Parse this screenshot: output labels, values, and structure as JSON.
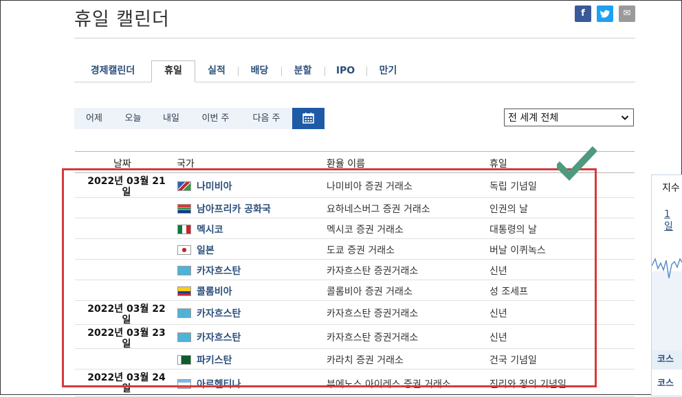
{
  "page": {
    "title": "휴일 캘린더"
  },
  "share": {
    "facebook": "f",
    "twitter": "t",
    "email": "✉"
  },
  "tabs": [
    {
      "label": "경제캘린더"
    },
    {
      "label": "휴일",
      "active": true
    },
    {
      "label": "실적"
    },
    {
      "label": "배당"
    },
    {
      "label": "분할"
    },
    {
      "label": "IPO"
    },
    {
      "label": "만기"
    }
  ],
  "date_buttons": {
    "yesterday": "어제",
    "today": "오늘",
    "tomorrow": "내일",
    "this_week": "이번 주",
    "next_week": "다음 주"
  },
  "region_select": {
    "value": "전 세계 전체"
  },
  "table": {
    "headers": {
      "date": "날짜",
      "country": "국가",
      "exchange": "환율 이름",
      "holiday": "휴일"
    },
    "rows": [
      {
        "date_line1": "2022년 03월 21",
        "date_line2": "일",
        "flag": "namibia",
        "country": "나미비아",
        "exchange": "나미비아 증권 거래소",
        "holiday": "독립 기념일"
      },
      {
        "date_line1": "",
        "date_line2": "",
        "flag": "south-africa",
        "country": "남아프리카 공화국",
        "exchange": "요하네스버그 증권 거래소",
        "holiday": "인권의 날"
      },
      {
        "date_line1": "",
        "date_line2": "",
        "flag": "mexico",
        "country": "멕시코",
        "exchange": "멕시코 증권 거래소",
        "holiday": "대통령의 날"
      },
      {
        "date_line1": "",
        "date_line2": "",
        "flag": "japan",
        "country": "일본",
        "exchange": "도쿄 증권 거래소",
        "holiday": "버날 이퀴녹스"
      },
      {
        "date_line1": "",
        "date_line2": "",
        "flag": "kazakhstan",
        "country": "카자흐스탄",
        "exchange": "카자흐스탄 증권거래소",
        "holiday": "신년"
      },
      {
        "date_line1": "",
        "date_line2": "",
        "flag": "colombia",
        "country": "콜롬비아",
        "exchange": "콜롬비아 증권 거래소",
        "holiday": "성 조세프"
      },
      {
        "date_line1": "2022년 03월 22",
        "date_line2": "일",
        "flag": "kazakhstan",
        "country": "카자흐스탄",
        "exchange": "카자흐스탄 증권거래소",
        "holiday": "신년"
      },
      {
        "date_line1": "2022년 03월 23",
        "date_line2": "일",
        "flag": "kazakhstan",
        "country": "카자흐스탄",
        "exchange": "카자흐스탄 증권거래소",
        "holiday": "신년"
      },
      {
        "date_line1": "",
        "date_line2": "",
        "flag": "pakistan",
        "country": "파키스탄",
        "exchange": "카라치 증권 거래소",
        "holiday": "건국 기념일"
      },
      {
        "date_line1": "2022년 03월 24",
        "date_line2": "일",
        "flag": "argentina",
        "country": "아르헨티나",
        "exchange": "부에노스 아이레스 증권 거래소",
        "holiday": "진리와 정의 기념일"
      }
    ]
  },
  "side_panel": {
    "title": "지수",
    "link_line1": "1",
    "link_line2": "일",
    "footer1": "코스",
    "footer2": "코스"
  },
  "colors": {
    "accent": "#1e5aa6",
    "link": "#2c4f7c",
    "highlight_box": "#d43a3a",
    "check": "#4e9a7e"
  }
}
